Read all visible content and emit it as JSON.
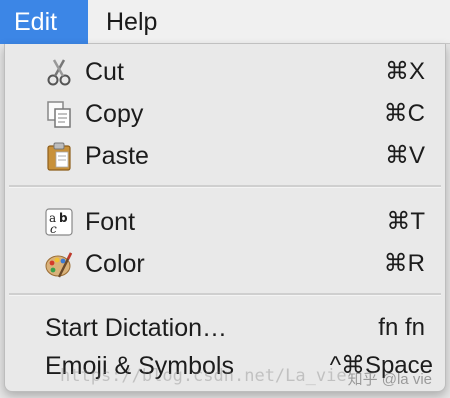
{
  "menubar": {
    "items": [
      {
        "label": "Edit",
        "active": true
      },
      {
        "label": "Help",
        "active": false
      }
    ]
  },
  "menu": {
    "groups": [
      [
        {
          "label": "Cut",
          "shortcut": "⌘X",
          "icon": "scissors-icon"
        },
        {
          "label": "Copy",
          "shortcut": "⌘C",
          "icon": "copy-icon"
        },
        {
          "label": "Paste",
          "shortcut": "⌘V",
          "icon": "clipboard-icon"
        }
      ],
      [
        {
          "label": "Font",
          "shortcut": "⌘T",
          "icon": "font-icon"
        },
        {
          "label": "Color",
          "shortcut": "⌘R",
          "icon": "palette-icon"
        }
      ],
      [
        {
          "label": "Start Dictation…",
          "shortcut": "fn fn"
        },
        {
          "label": "Emoji & Symbols",
          "shortcut": "^⌘Space"
        }
      ]
    ]
  },
  "watermark": {
    "url": "https://blog.csdn.net/La_vie",
    "credit": "知乎 @la vie"
  },
  "colors": {
    "menubar_active": "#3c86e6",
    "menu_bg": "#e9e9e9",
    "text": "#1c1c1c"
  }
}
